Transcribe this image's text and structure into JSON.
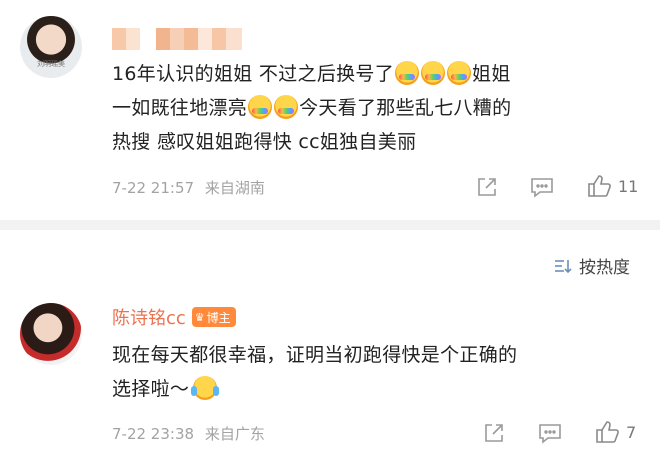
{
  "comments": [
    {
      "username": "",
      "avatar_caption": "刘明瑶美",
      "lines": [
        [
          "16年认识的姐姐 不过之后换号了",
          "[emoji]",
          "[emoji]",
          "[emoji]",
          "姐姐"
        ],
        [
          "一如既往地漂亮",
          "[emoji]",
          "[emoji]",
          "今天看了那些乱七八糟的"
        ],
        [
          "热搜 感叹姐姐跑得快 cc姐独自美丽"
        ]
      ],
      "text_line1": "16年认识的姐姐 不过之后换号了",
      "text_line1_tail": "姐姐",
      "text_line2_head": "一如既往地漂亮",
      "text_line2_tail": "今天看了那些乱七八糟的",
      "text_line3": "热搜 感叹姐姐跑得快 cc姐独自美丽",
      "timestamp": "7-22 21:57",
      "location": "来自湖南",
      "likes": "11"
    },
    {
      "username": "陈诗铭cc",
      "badge": "博主",
      "text_line1": "现在每天都很幸福，证明当初跑得快是个正确的",
      "text_line2": "选择啦～",
      "timestamp": "7-22 23:38",
      "location": "来自广东",
      "likes": "7"
    }
  ],
  "sort_label": "按热度",
  "icons": {
    "share": "share-icon",
    "comment": "comment-icon",
    "like": "thumbs-up-icon",
    "sort": "sort-icon"
  },
  "colors": {
    "username": "#eb7350",
    "badge_bg": "#ff8a3c",
    "meta": "#a3a3a3",
    "divider": "#f2f2f2"
  }
}
